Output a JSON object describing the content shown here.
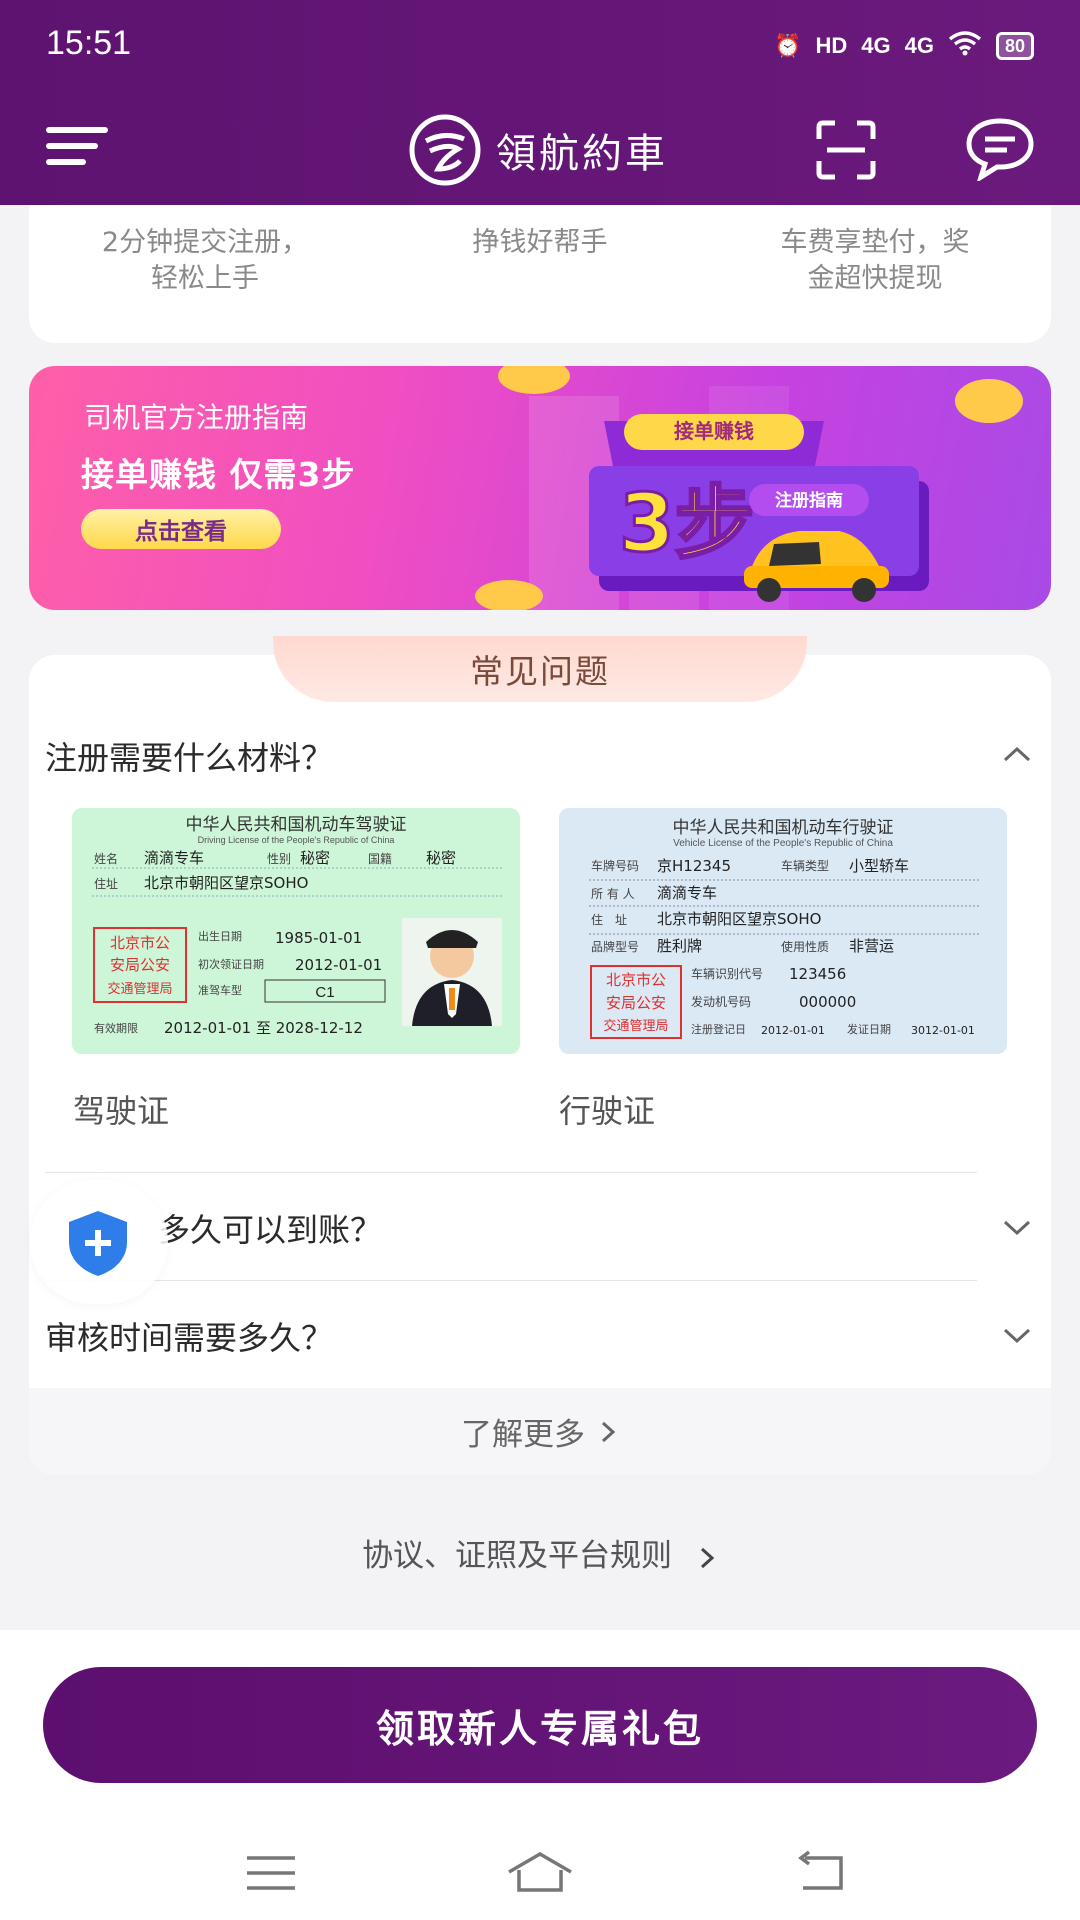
{
  "status": {
    "time": "15:51",
    "hd": "HD",
    "sig1": "4G",
    "sig2": "4G",
    "battery": "80"
  },
  "header": {
    "brand": "領航約車",
    "menu_icon": "menu-icon",
    "scan_icon": "scan-icon",
    "chat_icon": "chat-icon"
  },
  "features": [
    {
      "line1": "2分钟提交注册，",
      "line2": "轻松上手"
    },
    {
      "line1": "挣钱好帮手",
      "line2": ""
    },
    {
      "line1": "车费享垫付，奖",
      "line2": "金超快提现"
    }
  ],
  "banner": {
    "subtitle": "司机官方注册指南",
    "title": "接单赚钱 仅需3步",
    "button": "点击查看",
    "badge": "接单赚钱",
    "steps": "3步",
    "tag": "注册指南"
  },
  "faq": {
    "tab": "常见问题",
    "q1": "注册需要什么材料？",
    "driving_caption": "驾驶证",
    "vehicle_caption": "行驶证",
    "q2": "多久可以到账？",
    "q3": "审核时间需要多久？",
    "more": "了解更多"
  },
  "driving_license": {
    "title": "中华人民共和国机动车驾驶证",
    "title_en": "Driving License of the People's Republic of China",
    "name_label": "姓名",
    "name": "滴滴专车",
    "sex_label": "性别",
    "sex": "秘密",
    "nat_label": "国籍",
    "nat": "秘密",
    "addr_label": "住址",
    "addr": "北京市朝阳区望京SOHO",
    "dob_label": "出生日期",
    "dob": "1985-01-01",
    "first_label": "初次领证日期",
    "first": "2012-01-01",
    "class_label": "准驾车型",
    "class": "C1",
    "valid_label": "有效期限",
    "valid": "2012-01-01 至 2028-12-12",
    "stamp": "北京市公安局公安交通管理局"
  },
  "vehicle_license": {
    "title": "中华人民共和国机动车行驶证",
    "title_en": "Vehicle License of the People's Republic of China",
    "plate_label": "车牌号码",
    "plate": "京H12345",
    "type_label": "车辆类型",
    "type": "小型轿车",
    "owner_label": "所 有 人",
    "owner": "滴滴专车",
    "addr_label": "住　址",
    "addr": "北京市朝阳区望京SOHO",
    "model_label": "品牌型号",
    "model": "胜利牌",
    "use_label": "使用性质",
    "use": "非营运",
    "vin_label": "车辆识别代号",
    "vin": "123456",
    "engine_label": "发动机号码",
    "engine": "000000",
    "reg_label": "注册登记日",
    "reg": "2012-01-01",
    "issue_label": "发证日期",
    "issue": "3012-01-01",
    "stamp": "北京市公安局公安交通管理局"
  },
  "rules": "协议、证照及平台规则",
  "cta": "领取新人专属礼包",
  "colors": {
    "primary": "#5e1370",
    "banner": "#f04ec2",
    "accent": "#ffd84a"
  }
}
